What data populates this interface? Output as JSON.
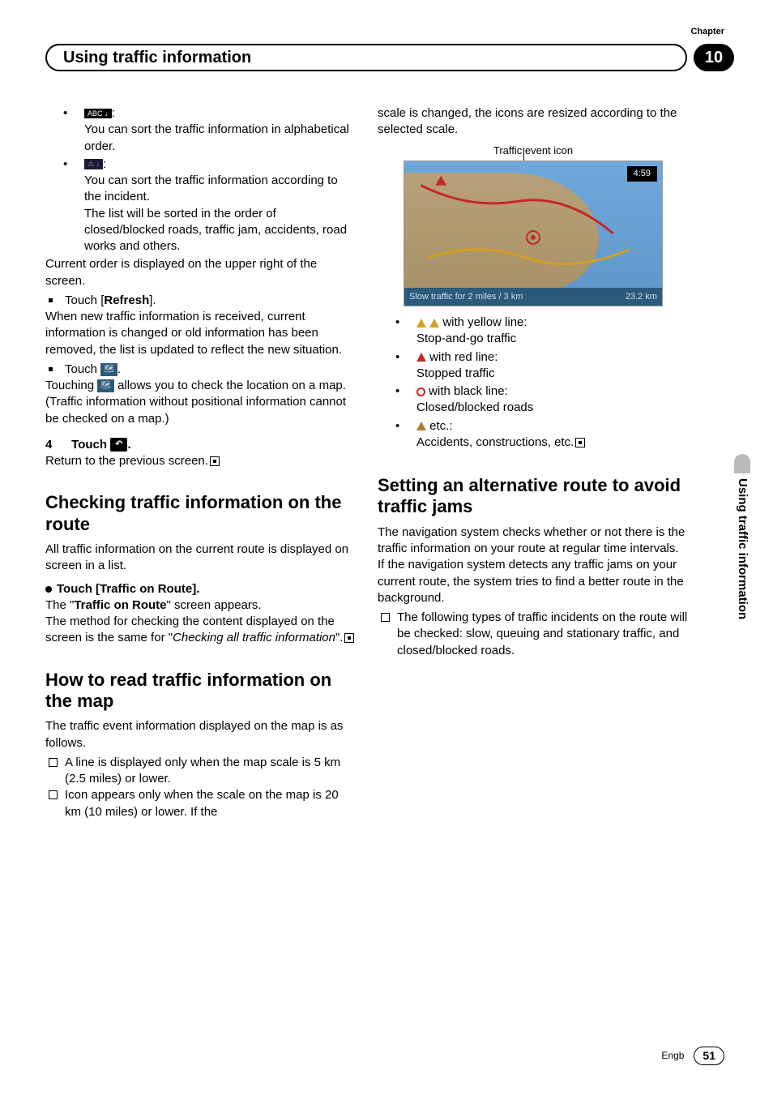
{
  "chapter": {
    "label": "Chapter",
    "number": "10"
  },
  "header": {
    "title": "Using traffic information"
  },
  "left": {
    "sort_alpha_icon": "ABC ↓",
    "sort_alpha_text": "You can sort the traffic information in alphabetical order.",
    "sort_incident_icon": "⚠ ↓",
    "sort_incident_1": "You can sort the traffic information according to the incident.",
    "sort_incident_2": "The list will be sorted in the order of closed/blocked roads, traffic jam, accidents, road works and others.",
    "current_order": "Current order is displayed on the upper right of the screen.",
    "refresh_touch": "Touch [",
    "refresh_label": "Refresh",
    "refresh_end": "].",
    "refresh_body": "When new traffic information is received, current information is changed or old information has been removed, the list is updated to reflect the new situation.",
    "touch_map_pre": "Touch ",
    "touch_map_icon": "🗺",
    "touch_map_post": ".",
    "touching_pre": "Touching ",
    "touching_post": " allows you to check the location on a map. (Traffic information without positional information cannot be checked on a map.)",
    "step4_num": "4",
    "step4_pre": "Touch ",
    "step4_icon": "↶",
    "step4_post": ".",
    "step4_body": "Return to the previous screen.",
    "h2a": "Checking traffic information on the route",
    "h2a_body1": "All traffic information on the current route is displayed on screen in a list.",
    "h2a_bullet_label": "Touch [Traffic on Route].",
    "h2a_body2a": "The \"",
    "h2a_body2b": "Traffic on Route",
    "h2a_body2c": "\" screen appears.",
    "h2a_body3a": "The method for checking the content displayed on the screen is the same for \"",
    "h2a_body3b": "Checking all traffic information",
    "h2a_body3c": "\".",
    "h2b": "How to read traffic information on the map",
    "h2b_body1": "The traffic event information displayed on the map is as follows.",
    "h2b_li1": "A line is displayed only when the map scale is 5 km (2.5 miles) or lower.",
    "h2b_li2": "Icon appears only when the scale on the map is 20 km (10 miles) or lower. If the"
  },
  "right": {
    "cont": "scale is changed, the icons are resized according to the selected scale.",
    "traffic_event_label": "Traffic event icon",
    "map_time": "4:59",
    "map_bottom_left": "Slow traffic for 2 miles / 3 km",
    "map_bottom_right": "23.2 km",
    "yellow_label": " with yellow line:",
    "yellow_body": "Stop-and-go traffic",
    "red_label": " with red line:",
    "red_body": "Stopped traffic",
    "black_label": " with black line:",
    "black_body": "Closed/blocked roads",
    "etc_label": " etc.:",
    "etc_body": "Accidents, constructions, etc.",
    "h2c": "Setting an alternative route to avoid traffic jams",
    "h2c_body": "The navigation system checks whether or not there is the traffic information on your route at regular time intervals. If the navigation system detects any traffic jams on your current route, the system tries to find a better route in the background.",
    "h2c_li1": "The following types of traffic incidents on the route will be checked: slow, queuing and stationary traffic, and closed/blocked roads."
  },
  "side_tab": "Using traffic information",
  "footer": {
    "lang": "Engb",
    "page": "51"
  }
}
